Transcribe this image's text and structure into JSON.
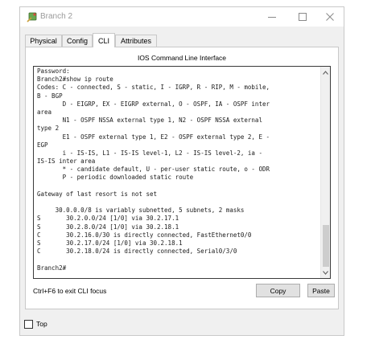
{
  "window": {
    "title": "Branch 2",
    "controls": {
      "minimize_icon": "minimize-icon",
      "maximize_icon": "maximize-icon",
      "close_icon": "close-icon"
    }
  },
  "tabs": [
    {
      "label": "Physical",
      "active": false
    },
    {
      "label": "Config",
      "active": false
    },
    {
      "label": "CLI",
      "active": true
    },
    {
      "label": "Attributes",
      "active": false
    }
  ],
  "panel": {
    "title": "IOS Command Line Interface"
  },
  "console": {
    "lines": [
      "Password:",
      "Branch2#show ip route",
      "Codes: C - connected, S - static, I - IGRP, R - RIP, M - mobile,",
      "B - BGP",
      "       D - EIGRP, EX - EIGRP external, O - OSPF, IA - OSPF inter",
      "area",
      "       N1 - OSPF NSSA external type 1, N2 - OSPF NSSA external",
      "type 2",
      "       E1 - OSPF external type 1, E2 - OSPF external type 2, E -",
      "EGP",
      "       i - IS-IS, L1 - IS-IS level-1, L2 - IS-IS level-2, ia -",
      "IS-IS inter area",
      "       * - candidate default, U - per-user static route, o - ODR",
      "       P - periodic downloaded static route",
      "",
      "Gateway of last resort is not set",
      "",
      "     30.0.0.0/8 is variably subnetted, 5 subnets, 2 masks",
      "S       30.2.0.0/24 [1/0] via 30.2.17.1",
      "S       30.2.8.0/24 [1/0] via 30.2.18.1",
      "C       30.2.16.0/30 is directly connected, FastEthernet0/0",
      "S       30.2.17.0/24 [1/0] via 30.2.18.1",
      "C       30.2.18.0/24 is directly connected, Serial0/3/0",
      "",
      "Branch2#"
    ]
  },
  "footer": {
    "focus_hint": "Ctrl+F6 to exit CLI focus",
    "copy_label": "Copy",
    "paste_label": "Paste"
  },
  "top_checkbox": {
    "label": "Top",
    "checked": false
  }
}
